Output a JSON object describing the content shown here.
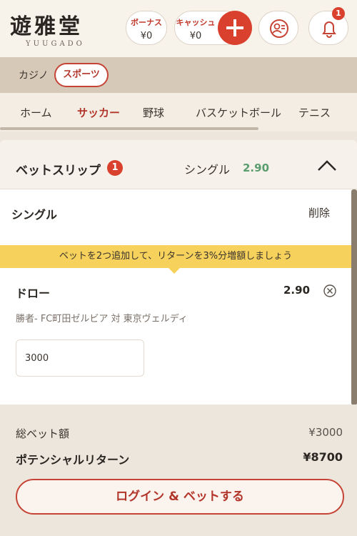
{
  "header": {
    "logo_text": "遊雅堂",
    "logo_sub": "YUUGADO",
    "bonus_label": "ボーナス",
    "bonus_value": "¥0",
    "cash_label": "キャッシュ",
    "cash_value": "¥0",
    "plus_icon": "plus-icon",
    "profile_icon": "profile-icon",
    "bell_icon": "bell-icon",
    "notification_count": "1"
  },
  "category": {
    "casino": "カジノ",
    "sports": "スポーツ"
  },
  "sport_tabs": [
    "ホーム",
    "サッカー",
    "野球",
    "バスケットボール",
    "テニス"
  ],
  "active_sport_tab": "サッカー",
  "bet_slip": {
    "title": "ベットスリップ",
    "count": "1",
    "type": "シングル",
    "type_odds": "2.90",
    "section_title": "シングル",
    "delete_label": "削除",
    "promo_banner": "ベットを2つ追加して、リターンを3%分増額しましょう",
    "selection": {
      "name": "ドロー",
      "odds": "2.90",
      "market": "勝者- FC町田ゼルビア 対 東京ヴェルディ",
      "stake": "3000"
    },
    "total_stake_label": "総ベット額",
    "total_stake_value": "¥3000",
    "potential_return_label": "ポテンシャルリターン",
    "potential_return_value": "¥8700",
    "login_button": "ログイン & ベットする"
  },
  "colors": {
    "accent": "#d9402e",
    "odds_green": "#5a9d6e",
    "banner_yellow": "#f6d15c"
  }
}
